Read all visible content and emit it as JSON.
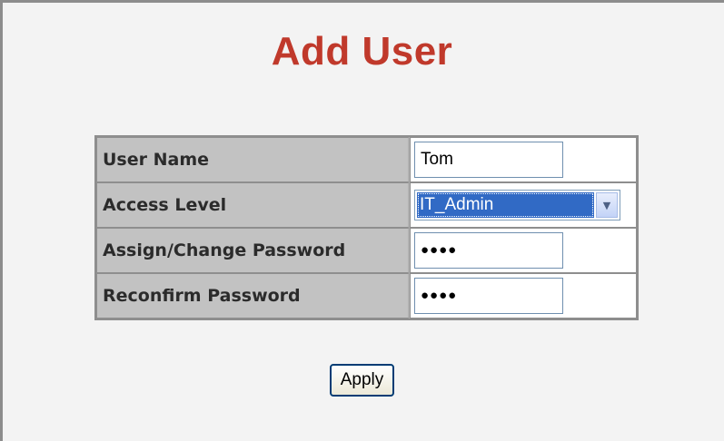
{
  "page": {
    "title": "Add User"
  },
  "form": {
    "rows": [
      {
        "label": "User Name",
        "type": "text",
        "value": "Tom"
      },
      {
        "label": "Access Level",
        "type": "select",
        "value": "IT_Admin"
      },
      {
        "label": "Assign/Change Password",
        "type": "password",
        "value": "●●●●"
      },
      {
        "label": "Reconfirm Password",
        "type": "password",
        "value": "●●●●"
      }
    ]
  },
  "actions": {
    "apply_label": "Apply"
  },
  "colors": {
    "title": "#c0392b",
    "label_bg": "#c2c2c2",
    "page_bg": "#f3f3f3",
    "select_highlight": "#316ac5"
  }
}
